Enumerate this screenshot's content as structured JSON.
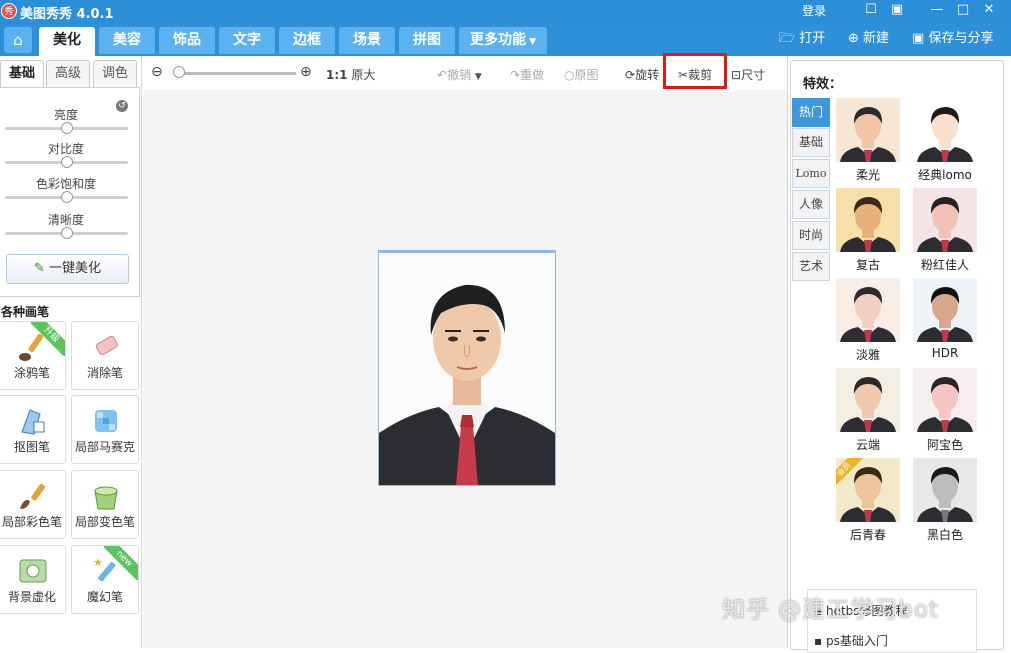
{
  "app": {
    "title": "美图秀秀 4.0.1",
    "logo_text": "秀",
    "login": "登录"
  },
  "window": {
    "icons": [
      "message-icon",
      "skin-icon",
      "minimize-icon",
      "maximize-icon",
      "close-icon"
    ]
  },
  "tabs": [
    {
      "label": "美化",
      "active": true
    },
    {
      "label": "美容"
    },
    {
      "label": "饰品"
    },
    {
      "label": "文字"
    },
    {
      "label": "边框"
    },
    {
      "label": "场景"
    },
    {
      "label": "拼图"
    },
    {
      "label": "更多功能"
    }
  ],
  "header_actions": {
    "open": "打开",
    "new": "新建",
    "save": "保存与分享"
  },
  "left": {
    "subtabs": [
      "基础",
      "高级",
      "调色"
    ],
    "sliders": [
      {
        "label": "亮度",
        "value": 50
      },
      {
        "label": "对比度",
        "value": 50
      },
      {
        "label": "色彩饱和度",
        "value": 50
      },
      {
        "label": "清晰度",
        "value": 50
      }
    ],
    "onekey": "一键美化",
    "brush_title": "各种画笔",
    "brushes": [
      {
        "label": "涂鸦笔",
        "badge": "升级"
      },
      {
        "label": "消除笔"
      },
      {
        "label": "抠图笔"
      },
      {
        "label": "局部马赛克"
      },
      {
        "label": "局部彩色笔"
      },
      {
        "label": "局部变色笔"
      },
      {
        "label": "背景虚化"
      },
      {
        "label": "魔幻笔",
        "badge": "new"
      }
    ]
  },
  "toolbar": {
    "ratio": "1:1",
    "original": "原大",
    "undo": "撤销",
    "redo": "重做",
    "orig_img": "原图",
    "rotate": "旋转",
    "crop": "裁剪",
    "size": "尺寸"
  },
  "right": {
    "title": "特效：",
    "vtabs": [
      "热门",
      "基础",
      "Lomo",
      "人像",
      "时尚",
      "艺术"
    ],
    "effects": [
      {
        "label": "柔光"
      },
      {
        "label": "经典lomo"
      },
      {
        "label": "复古"
      },
      {
        "label": "粉红佳人"
      },
      {
        "label": "淡雅"
      },
      {
        "label": "HDR"
      },
      {
        "label": "云端"
      },
      {
        "label": "阿宝色"
      },
      {
        "label": "后青春",
        "badge": "会员"
      },
      {
        "label": "黑白色"
      }
    ],
    "links": [
      "hetbs修图教程",
      "ps基础入门"
    ]
  },
  "watermark": "知乎 @建工学习bot",
  "colors": {
    "titlebar": "#2b8fd8",
    "tab_inactive": "#5cb2ee",
    "highlight": "#e01818",
    "vtab_active": "#3d97dd"
  }
}
